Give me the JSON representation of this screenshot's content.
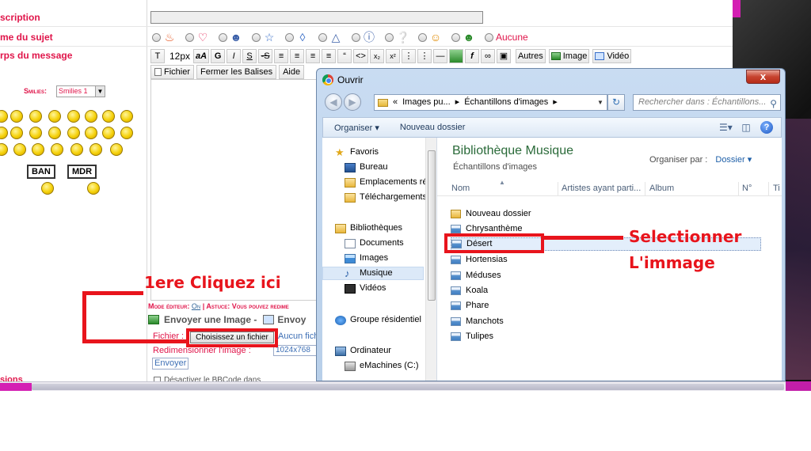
{
  "forum": {
    "labels": {
      "description": "scription",
      "icon": "me du sujet",
      "body": "rps du message",
      "bottom": "sions"
    },
    "topic_icons": [
      "flame-icon",
      "heart-icon",
      "smile-ball-icon",
      "star-icon",
      "speech-bubble-icon",
      "warning-icon",
      "info-icon",
      "question-icon",
      "crazy-face-icon",
      "grin-face-icon"
    ],
    "aucune_label": "Aucune",
    "toolbar": {
      "size_label": "12px",
      "buttons": [
        "G",
        "I",
        "S",
        "-S"
      ],
      "autres": "Autres",
      "image": "Image",
      "video": "Vidéo"
    },
    "toolbar2": {
      "fichier": "Fichier",
      "fermer": "Fermer les Balises",
      "aide": "Aide"
    },
    "smilies": {
      "label": "Smilies:",
      "select_value": "Smilies 1",
      "sign_ban": "BAN",
      "sign_mdr": "MDR"
    },
    "mode_line": {
      "prefix": "Mode éditeur:",
      "on": "On",
      "sep": "|",
      "astuce": "Astuce: Vous pouvez redime"
    },
    "upload": {
      "title": "Envoyer une Image -",
      "title2": "Envoy",
      "fichier_label": "Fichier :",
      "choose_button": "Choisissez un fichier",
      "no_file": "Aucun fich",
      "resize_label": "Redimensionner l'image :",
      "resize_value": "1024x768",
      "send_button": "Envoyer"
    },
    "bottom_text": "Désactiver le BBCode dans"
  },
  "dialog": {
    "title": "Ouvrir",
    "close_label": "x",
    "address": {
      "chevrons": "«",
      "crumb1": "Images pu...",
      "arrow1": "▸",
      "crumb2": "Échantillons d'images",
      "arrow2": "▸"
    },
    "search_placeholder": "Rechercher dans : Échantillons...",
    "commands": {
      "organize": "Organiser ▾",
      "new_folder": "Nouveau dossier"
    },
    "nav": {
      "favoris": "Favoris",
      "bureau": "Bureau",
      "emplacements": "Emplacements ré",
      "telechargements": "Téléchargements",
      "bibliotheques": "Bibliothèques",
      "documents": "Documents",
      "images": "Images",
      "musique": "Musique",
      "videos": "Vidéos",
      "groupe": "Groupe résidentiel",
      "ordinateur": "Ordinateur",
      "emachines": "eMachines (C:)"
    },
    "library_title": "Bibliothèque Musique",
    "library_subtitle": "Échantillons d'images",
    "organize_by_label": "Organiser par :",
    "organize_by_value": "Dossier ▾",
    "columns": [
      "Nom",
      "Artistes ayant parti...",
      "Album",
      "N°",
      "Ti"
    ],
    "files": [
      {
        "name": "Nouveau dossier",
        "type": "folder"
      },
      {
        "name": "Chrysanthème",
        "type": "image"
      },
      {
        "name": "Désert",
        "type": "image"
      },
      {
        "name": "Hortensias",
        "type": "image"
      },
      {
        "name": "Méduses",
        "type": "image"
      },
      {
        "name": "Koala",
        "type": "image"
      },
      {
        "name": "Phare",
        "type": "image"
      },
      {
        "name": "Manchots",
        "type": "image"
      },
      {
        "name": "Tulipes",
        "type": "image"
      }
    ]
  },
  "annotations": {
    "step1": "1ere Cliquez ici",
    "step2_line1": "Selectionner",
    "step2_line2": "L'immage",
    "color": "#e8141c"
  }
}
